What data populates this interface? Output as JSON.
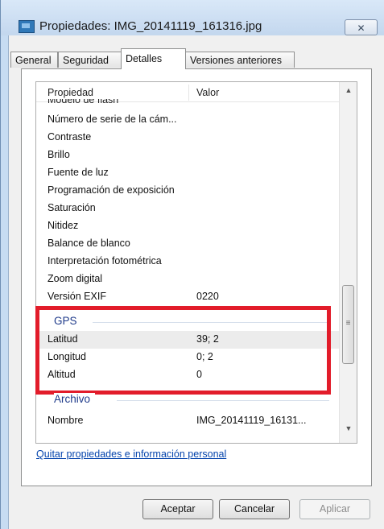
{
  "window": {
    "title": "Propiedades: IMG_20141119_161316.jpg",
    "close_label": "✕"
  },
  "tabs": [
    {
      "label": "General",
      "active": false
    },
    {
      "label": "Seguridad",
      "active": false
    },
    {
      "label": "Detalles",
      "active": true
    },
    {
      "label": "Versiones anteriores",
      "active": false
    }
  ],
  "list": {
    "header": {
      "property": "Propiedad",
      "value": "Valor"
    },
    "cut_off_row": "Modelo de flash",
    "rows": [
      {
        "name": "Número de serie de la cám...",
        "value": ""
      },
      {
        "name": "Contraste",
        "value": ""
      },
      {
        "name": "Brillo",
        "value": ""
      },
      {
        "name": "Fuente de luz",
        "value": ""
      },
      {
        "name": "Programación de exposición",
        "value": ""
      },
      {
        "name": "Saturación",
        "value": ""
      },
      {
        "name": "Nitidez",
        "value": ""
      },
      {
        "name": "Balance de blanco",
        "value": ""
      },
      {
        "name": "Interpretación fotométrica",
        "value": ""
      },
      {
        "name": "Zoom digital",
        "value": ""
      },
      {
        "name": "Versión EXIF",
        "value": "0220"
      }
    ],
    "gps_group": "GPS",
    "gps_rows": [
      {
        "name": "Latitud",
        "value": "39; 2"
      },
      {
        "name": "Longitud",
        "value": "0; 2"
      },
      {
        "name": "Altitud",
        "value": "0"
      }
    ],
    "file_group": "Archivo",
    "file_rows": [
      {
        "name": "Nombre",
        "value": "IMG_20141119_16131..."
      }
    ]
  },
  "link": "Quitar propiedades e información personal",
  "buttons": {
    "ok": "Aceptar",
    "cancel": "Cancelar",
    "apply": "Aplicar"
  },
  "colors": {
    "highlight_box": "#e21c2a",
    "group_label": "#1e3a8a",
    "link": "#0645ad"
  }
}
